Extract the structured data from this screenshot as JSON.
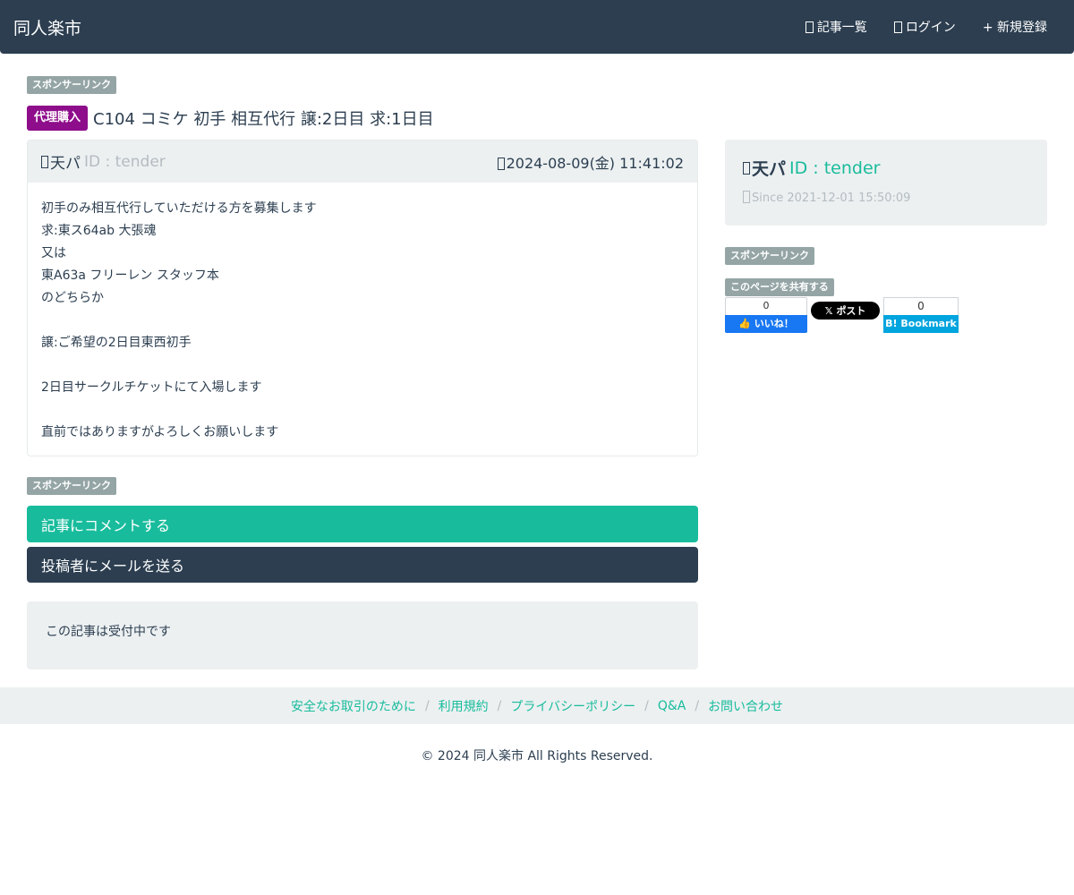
{
  "nav": {
    "brand": "同人楽市",
    "links": [
      {
        "label": "記事一覧",
        "icon": "list-icon"
      },
      {
        "label": "ログイン",
        "icon": "login-icon"
      },
      {
        "label": "+ 新規登録",
        "icon": ""
      }
    ]
  },
  "sponsor_label": "スポンサーリンク",
  "post": {
    "category_badge": "代理購入",
    "title": "C104 コミケ 初手 相互代行 譲:2日目 求:1日目",
    "author": "天パ",
    "author_id": "ID : tender",
    "datetime": "2024-08-09(金) 11:41:02",
    "body_lines": [
      "初手のみ相互代行していただける方を募集します",
      "求:東ス64ab 大張魂",
      "又は",
      "東A63a フリーレン スタッフ本",
      "のどちらか",
      "",
      "譲:ご希望の2日目東西初手",
      "",
      "2日目サークルチケットにて入場します",
      "",
      "直前ではありますがよろしくお願いします"
    ]
  },
  "actions": {
    "comment_label": "記事にコメントする",
    "mail_label": "投稿者にメールを送る"
  },
  "status_text": "この記事は受付中です",
  "sidebar": {
    "user_name": "天パ",
    "user_id": "ID : tender",
    "since": "Since 2021-12-01 15:50:09",
    "share_label": "このページを共有する",
    "facebook": {
      "count": "0",
      "label": "いいね！"
    },
    "x_post": {
      "label": "ポスト"
    },
    "hatena": {
      "count": "0",
      "label": "Bookmark"
    }
  },
  "footer": {
    "links": [
      "安全なお取引のために",
      "利用規約",
      "プライバシーポリシー",
      "Q&A",
      "お問い合わせ"
    ],
    "copyright": "© 2024 同人楽市 All Rights Reserved."
  },
  "colors": {
    "navbar": "#2c3e50",
    "accent": "#18bc9c",
    "badge": "#8e0d8b",
    "well": "#ecf0f1"
  }
}
